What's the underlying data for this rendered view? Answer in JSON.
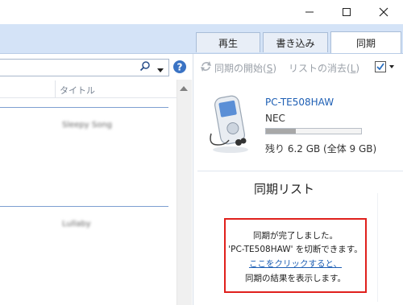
{
  "window": {
    "controls": [
      "minimize",
      "maximize",
      "close"
    ]
  },
  "tabs": [
    {
      "label": "再生",
      "active": false
    },
    {
      "label": "書き込み",
      "active": false
    },
    {
      "label": "同期",
      "active": true
    }
  ],
  "left": {
    "column_title": "タイトル",
    "rows": [
      "Sleepy Song",
      "Lullaby"
    ]
  },
  "toolbar": {
    "start_sync": "同期の開始(",
    "start_sync_key": "S",
    "start_sync_end": ")",
    "clear_list": "リストの消去(",
    "clear_list_key": "L",
    "clear_list_end": ")"
  },
  "device": {
    "name": "PC-TE508HAW",
    "maker": "NEC",
    "storage_text": "残り 6.2 GB (全体 9 GB)",
    "storage_used_fraction": 0.31
  },
  "sync_list": {
    "title": "同期リスト",
    "message_line1": "同期が完了しました。",
    "message_line2": "'PC-TE508HAW' を切断できます。",
    "link_text": "ここをクリックすると、",
    "message_line4": "同期の結果を表示します。"
  },
  "colors": {
    "accent_red": "#e0201c",
    "link": "#1e5fb4",
    "tab_strip": "#d4e3f7"
  }
}
